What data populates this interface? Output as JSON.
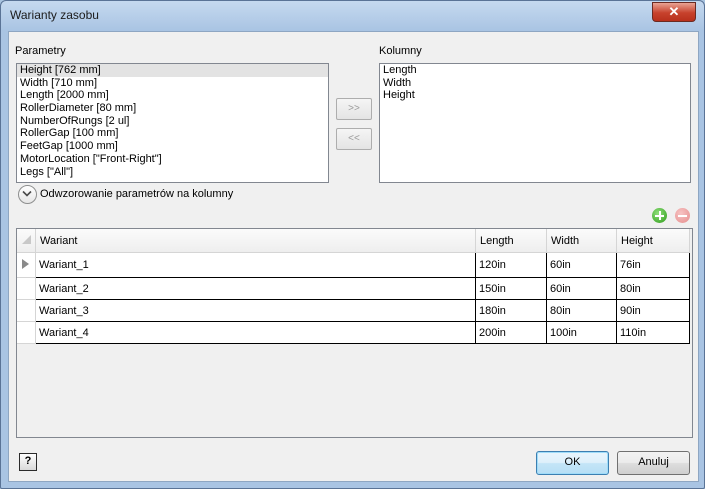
{
  "window": {
    "title": "Warianty zasobu",
    "close_label": "✕"
  },
  "parameters": {
    "label": "Parametry",
    "items": [
      "Height [762 mm]",
      "Width [710 mm]",
      "Length [2000 mm]",
      "RollerDiameter [80 mm]",
      "NumberOfRungs [2 ul]",
      "RollerGap [100 mm]",
      "FeetGap [1000 mm]",
      "MotorLocation [\"Front-Right\"]",
      "Legs [\"All\"]"
    ],
    "selected_index": 0
  },
  "move_right_label": ">>",
  "move_left_label": "<<",
  "columns": {
    "label": "Kolumny",
    "items": [
      "Length",
      "Width",
      "Height"
    ]
  },
  "mapping_label": "Odwzorowanie parametrów na kolumny",
  "grid": {
    "headers": [
      "Wariant",
      "Length",
      "Width",
      "Height"
    ],
    "rows": [
      [
        "Wariant_1",
        "120in",
        "60in",
        "76in"
      ],
      [
        "Wariant_2",
        "150in",
        "60in",
        "80in"
      ],
      [
        "Wariant_3",
        "180in",
        "80in",
        "90in"
      ],
      [
        "Wariant_4",
        "200in",
        "100in",
        "110in"
      ]
    ],
    "current_row": 0
  },
  "help_label": "?",
  "ok_label": "OK",
  "cancel_label": "Anuluj"
}
